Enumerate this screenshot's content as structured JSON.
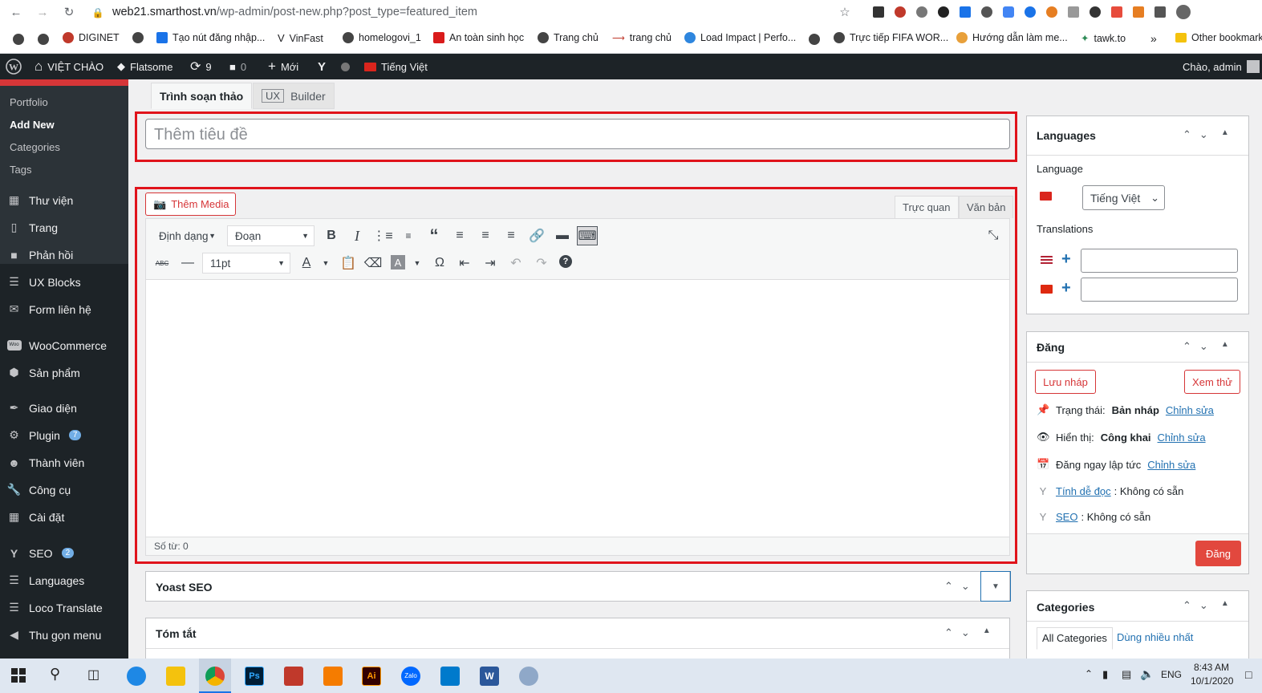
{
  "browser": {
    "url_host": "web21.smarthost.vn",
    "url_path": "/wp-admin/post-new.php?post_type=featured_item",
    "bookmarks": [
      "DIGINET",
      "Tạo nút đăng nhập...",
      "VinFast",
      "homelogovi_1",
      "An toàn sinh học",
      "Trang chủ",
      "trang chủ",
      "Load Impact | Perfo...",
      "Trực tiếp FIFA WOR...",
      "Hướng dẫn làm me...",
      "tawk.to"
    ],
    "bookmarks_more": "»",
    "other_bookmarks": "Other bookmarks"
  },
  "adminbar": {
    "site": "VIỆT CHÀO",
    "theme": "Flatsome",
    "updates": "9",
    "comments": "0",
    "new": "Mới",
    "language": "Tiếng Việt",
    "greeting": "Chào, admin"
  },
  "sidebar": {
    "submenu": [
      "Portfolio",
      "Add New",
      "Categories",
      "Tags"
    ],
    "items": [
      {
        "label": "Thư viện",
        "icon": "media-icon"
      },
      {
        "label": "Trang",
        "icon": "page-icon"
      },
      {
        "label": "Phản hồi",
        "icon": "comment-icon"
      },
      {
        "label": "UX Blocks",
        "icon": "blocks-icon"
      },
      {
        "label": "Form liên hệ",
        "icon": "mail-icon"
      },
      {
        "label": "WooCommerce",
        "icon": "woo-icon"
      },
      {
        "label": "Sản phẩm",
        "icon": "product-icon"
      },
      {
        "label": "Giao diện",
        "icon": "brush-icon"
      },
      {
        "label": "Plugin",
        "icon": "plugin-icon",
        "badge": "7"
      },
      {
        "label": "Thành viên",
        "icon": "user-icon"
      },
      {
        "label": "Công cụ",
        "icon": "wrench-icon"
      },
      {
        "label": "Cài đặt",
        "icon": "settings-icon"
      },
      {
        "label": "SEO",
        "icon": "yoast-icon",
        "badge": "2"
      },
      {
        "label": "Languages",
        "icon": "language-icon"
      },
      {
        "label": "Loco Translate",
        "icon": "translate-icon"
      },
      {
        "label": "Thu gọn menu",
        "icon": "collapse-icon"
      }
    ]
  },
  "editor_tabs": {
    "classic": "Trình soạn thảo",
    "ux": "UX",
    "builder": "Builder"
  },
  "title_placeholder": "Thêm tiêu đề",
  "editor": {
    "add_media": "Thêm Media",
    "visual_tab": "Trực quan",
    "text_tab": "Văn bản",
    "format_select": "Định dạng",
    "paragraph_select": "Đoạn",
    "font_size_select": "11pt",
    "word_count": "Số từ: 0"
  },
  "yoast_box": "Yoast SEO",
  "excerpt_box": "Tóm tắt",
  "languages_box": {
    "title": "Languages",
    "language_label": "Language",
    "selected_language": "Tiếng Việt",
    "translations_label": "Translations"
  },
  "publish_box": {
    "title": "Đăng",
    "save_draft": "Lưu nháp",
    "preview": "Xem thử",
    "status_label": "Trạng thái:",
    "status_value": "Bản nháp",
    "visibility_label": "Hiển thị:",
    "visibility_value": "Công khai",
    "schedule_label": "Đăng ngay lập tức",
    "edit_link": "Chỉnh sửa",
    "readability_link": "Tính dễ đọc",
    "readability_value": ": Không có sẵn",
    "seo_link": "SEO",
    "seo_value": ": Không có sẵn",
    "publish_button": "Đăng"
  },
  "categories_box": {
    "title": "Categories",
    "tab_all": "All Categories",
    "tab_popular": "Dùng nhiều nhất"
  },
  "taskbar": {
    "language": "ENG",
    "time": "8:43 AM",
    "date": "10/1/2020"
  },
  "colors": {
    "admin_dark": "#1d2327",
    "highlight_red": "#e0131b",
    "wp_blue": "#2271b1",
    "publish_red": "#e2483e"
  }
}
